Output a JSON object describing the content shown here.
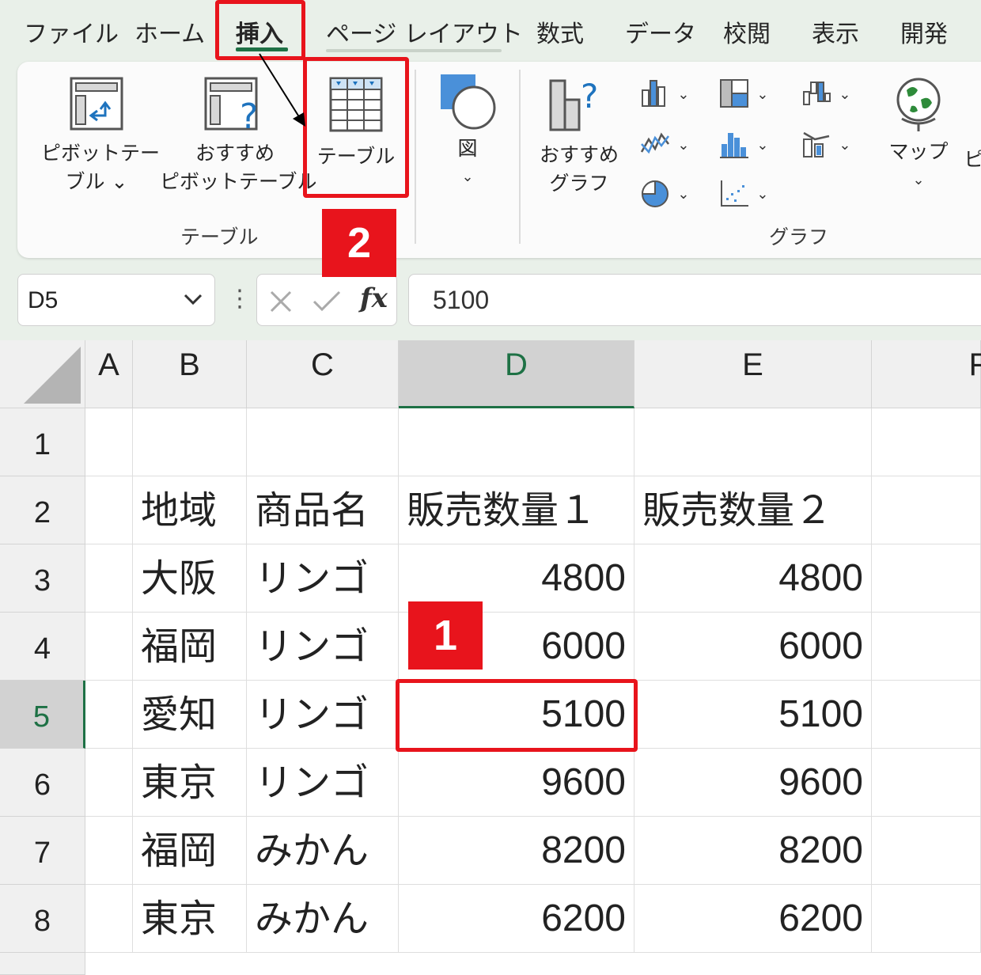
{
  "ribbon_tabs": [
    "ファイル",
    "ホーム",
    "挿入",
    "ページ レイアウト",
    "数式",
    "データ",
    "校閲",
    "表示",
    "開発"
  ],
  "active_tab": "挿入",
  "ribbon": {
    "pivot_table_line1": "ピボットテー",
    "pivot_table_line2": "ブル ⌄",
    "recommended_pivot_line1": "おすすめ",
    "recommended_pivot_line2": "ピボットテーブル",
    "table_label": "テーブル",
    "table_group_label": "テーブル",
    "shapes_label": "図",
    "recommended_chart_line1": "おすすめ",
    "recommended_chart_line2": "グラフ",
    "charts_group_label": "グラフ",
    "map_label": "マップ",
    "cut_label": "ピ"
  },
  "formula_bar": {
    "name_box": "D5",
    "fx": "fx",
    "value": "5100"
  },
  "columns": [
    "A",
    "B",
    "C",
    "D",
    "E",
    "F"
  ],
  "selected_column": "D",
  "rows": [
    "1",
    "2",
    "3",
    "4",
    "5",
    "6",
    "7",
    "8"
  ],
  "selected_row": "5",
  "table": {
    "header": [
      "地域",
      "商品名",
      "販売数量１",
      "販売数量２"
    ],
    "data": [
      [
        "大阪",
        "リンゴ",
        "4800",
        "4800"
      ],
      [
        "福岡",
        "リンゴ",
        "6000",
        "6000"
      ],
      [
        "愛知",
        "リンゴ",
        "5100",
        "5100"
      ],
      [
        "東京",
        "リンゴ",
        "9600",
        "9600"
      ],
      [
        "福岡",
        "みかん",
        "8200",
        "8200"
      ],
      [
        "東京",
        "みかん",
        "6200",
        "6200"
      ]
    ]
  },
  "annotations": {
    "step1": "1",
    "step2": "2",
    "color": "#e8141c"
  },
  "colors": {
    "accent": "#1e7145",
    "ribbon_bg": "#e9f0e9"
  }
}
